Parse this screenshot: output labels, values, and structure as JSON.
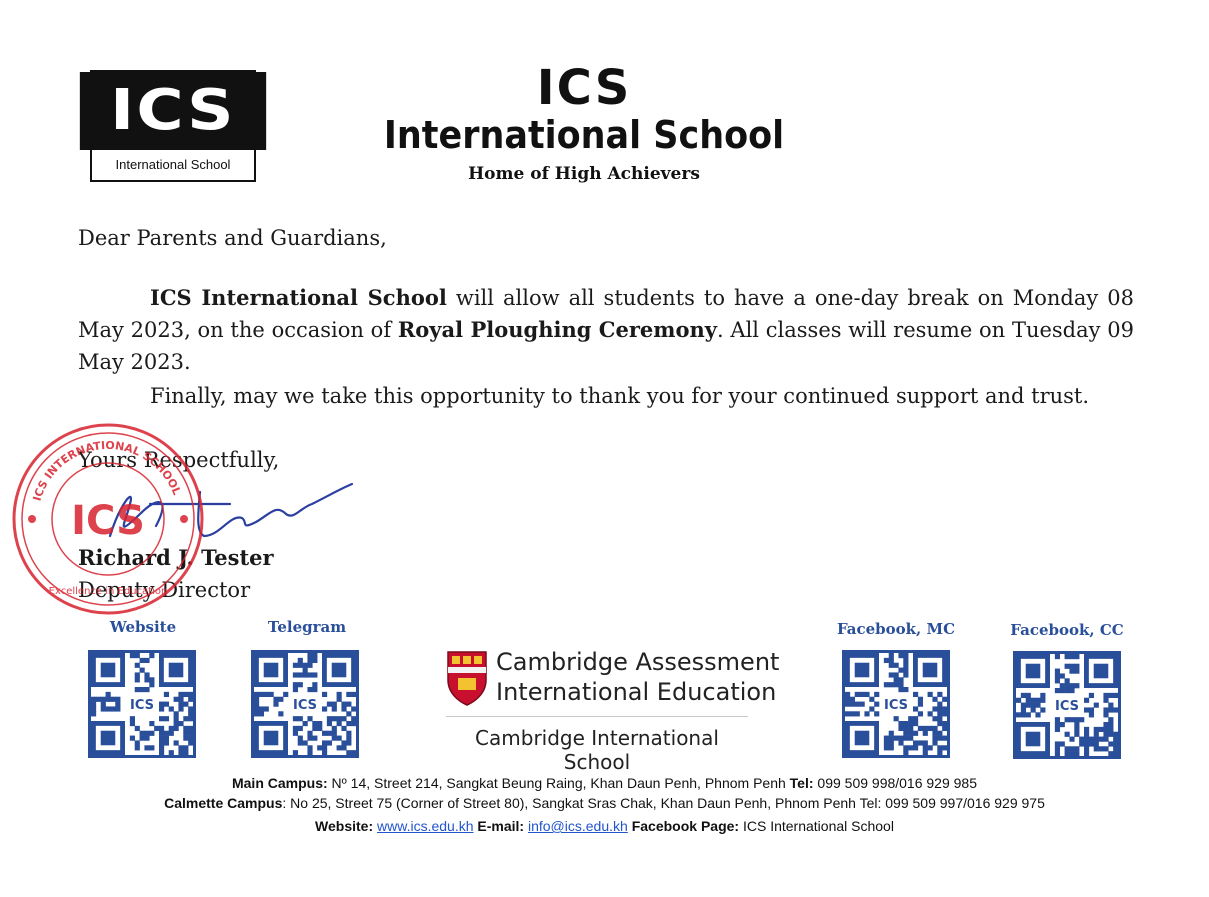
{
  "header": {
    "logo_text": "ICS",
    "logo_subtitle": "International School",
    "title_line1": "ICS",
    "title_line2": "International School",
    "motto": "Home of High Achievers"
  },
  "letter": {
    "greeting": "Dear Parents and Guardians,",
    "para1_bold_lead": "ICS International School",
    "para1_text_a": " will allow all students to have a one-day break on Monday 08 May 2023, on the occasion of ",
    "para1_bold_event": "Royal Ploughing Ceremony",
    "para1_text_b": ". All classes will resume on Tuesday 09 May 2023.",
    "para2": "Finally, may we take this opportunity to thank you for your continued support and trust.",
    "closing": "Yours Respectfully,",
    "signer_name": "Richard J. Tester",
    "signer_title": "Deputy Director"
  },
  "stamp": {
    "text": "ICS INTERNATIONAL SCHOOL",
    "center": "ICS",
    "motto": "Excellence in Education"
  },
  "qr_codes": [
    {
      "label": "Website"
    },
    {
      "label": "Telegram"
    },
    {
      "label": "Facebook, MC"
    },
    {
      "label": "Facebook, CC"
    }
  ],
  "qr_center_text": "ICS",
  "cambridge": {
    "line1": "Cambridge Assessment",
    "line2": "International Education",
    "line3": "Cambridge International School"
  },
  "footer": {
    "main_label": "Main Campus:",
    "main_text": " Nº 14, Street 214, Sangkat Beung Raing, Khan Daun Penh, Phnom Penh ",
    "main_tel_label": "Tel:",
    "main_tel": " 099 509 998/016 929 985",
    "calmette_label": "Calmette Campus",
    "calmette_text": ": No 25, Street 75 (Corner of Street 80), Sangkat Sras Chak, Khan Daun Penh, Phnom Penh Tel: 099 509 997/016 929 975",
    "website_label": "Website:",
    "website_url": "www.ics.edu.kh",
    "email_label": "E-mail:",
    "email": "info@ics.edu.kh",
    "facebook_label": "Facebook Page:",
    "facebook_page": " ICS International School"
  },
  "colors": {
    "qr_blue": "#2a4f9a",
    "stamp_red": "#d8232f",
    "signature_blue": "#2b3fa0",
    "link_blue": "#2255cc"
  }
}
